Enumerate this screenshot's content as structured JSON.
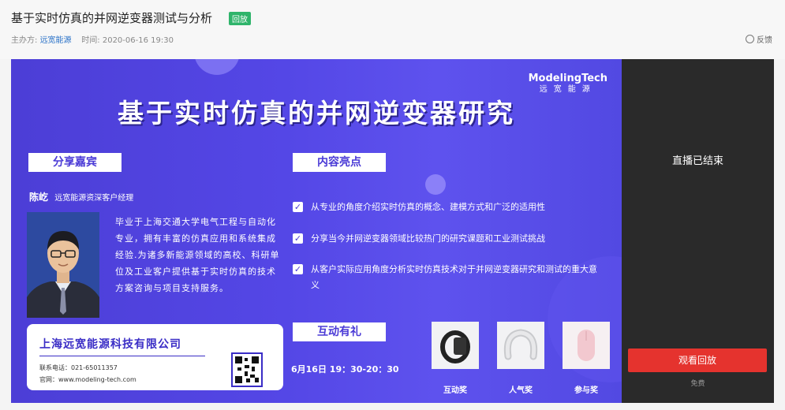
{
  "page": {
    "title": "基于实时仿真的并网逆变器测试与分析",
    "badge": "回放",
    "organizer_label": "主办方:",
    "organizer": "远宽能源",
    "time_label": "时间:",
    "time": "2020-06-16 19:30",
    "feedback": "反馈"
  },
  "banner": {
    "brand_en": "ModelingTech",
    "brand_cn": "远宽能源",
    "title": "基于实时仿真的并网逆变器研究",
    "speaker_tag": "分享嘉宾",
    "highlights_tag": "内容亮点",
    "speaker_name": "陈屹",
    "speaker_role": "远宽能源资深客户经理",
    "bio": "毕业于上海交通大学电气工程与自动化专业，拥有丰富的仿真应用和系统集成经验.为诸多新能源领域的高校、科研单位及工业客户提供基于实时仿真的技术方案咨询与项目支持服务。",
    "company_name": "上海远宽能源科技有限公司",
    "phone": "联系电话：021-65011357",
    "website": "官网：www.modeling-tech.com",
    "highlights": [
      "从专业的角度介绍实时仿真的概念、建模方式和广泛的适用性",
      "分享当今并网逆变器领域比较热门的研究课题和工业测试挑战",
      "从客户实际应用角度分析实时仿真技术对于并网逆变器研究和测试的重大意义"
    ],
    "interaction_tag": "互动有礼",
    "event_time": "6月16日 19：30-20：30",
    "prizes": [
      "互动奖",
      "人气奖",
      "参与奖"
    ]
  },
  "side": {
    "status": "直播已结束",
    "replay_button": "观看回放",
    "price": "免费"
  },
  "colors": {
    "accent": "#e5332e",
    "banner": "#5447e6",
    "badge": "#2fb46b"
  }
}
